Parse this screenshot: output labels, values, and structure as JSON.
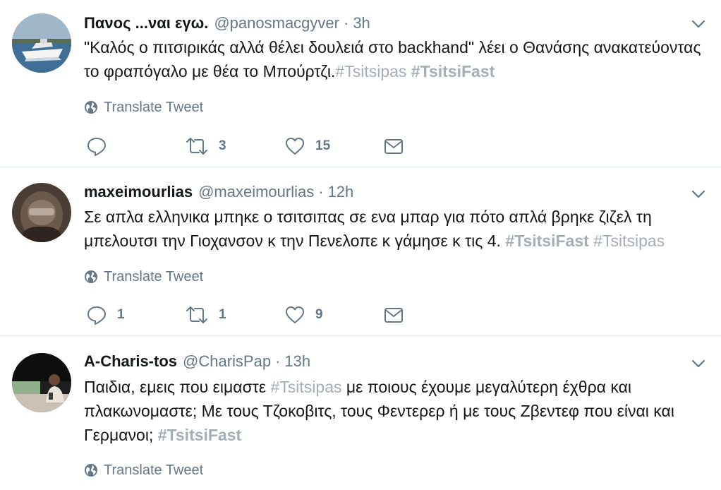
{
  "tweets": [
    {
      "name": "Πανος ...ναι εγω.",
      "handle": "@panosmacgyver",
      "separator": "·",
      "time": "3h",
      "text_pre": "\"Καλός ο πιτσιρικάς αλλά θέλει δουλειά στο backhand\" λέει ο Θανάσης ανακατεύοντας το φραπόγαλο με θέα το Μπούρτζι.",
      "hashtag1": "#Tsitsipas",
      "text_mid": " ",
      "hashtag2": "#TsitsiFast",
      "translate_label": "Translate Tweet",
      "reply_count": "",
      "retweet_count": "3",
      "like_count": "15",
      "avatar_icon": "yacht-photo-avatar"
    },
    {
      "name": "maxeimourlias",
      "handle": "@maxeimourlias",
      "separator": "·",
      "time": "12h",
      "text_pre": "Σε απλα ελληνικα μπηκε ο τσιτσιπας σε ενα μπαρ για πότο απλά βρηκε ζιζελ τη μπελουτσι την Γιοχανσον κ την Πενελοπε κ γάμησε κ τις 4. ",
      "hashtag1": "#TsitsiFast",
      "text_mid": " ",
      "hashtag2": "#Tsitsipas",
      "translate_label": "Translate Tweet",
      "reply_count": "1",
      "retweet_count": "1",
      "like_count": "9",
      "avatar_icon": "hooded-figure-avatar"
    },
    {
      "name": "A-Charis-tos",
      "handle": "@CharisPap",
      "separator": "·",
      "time": "13h",
      "text_pre": "Παιδια, εμεις που ειμαστε ",
      "hashtag1": "#Tsitsipas",
      "text_mid": " με ποιους έχουμε μεγαλύτερη έχθρα και πλακωνομαστε; Με τους Τζοκοβιτς, τους Φεντερερ ή με τους Ζβεντεφ που είναι και Γερμανοι; ",
      "hashtag2": "#TsitsiFast",
      "translate_label": "Translate Tweet",
      "avatar_icon": "man-sitting-photo-avatar"
    }
  ],
  "colors": {
    "text": "#14171a",
    "muted": "#657786",
    "hashtag": "#a4aeb7",
    "border": "#e6ecf0"
  }
}
